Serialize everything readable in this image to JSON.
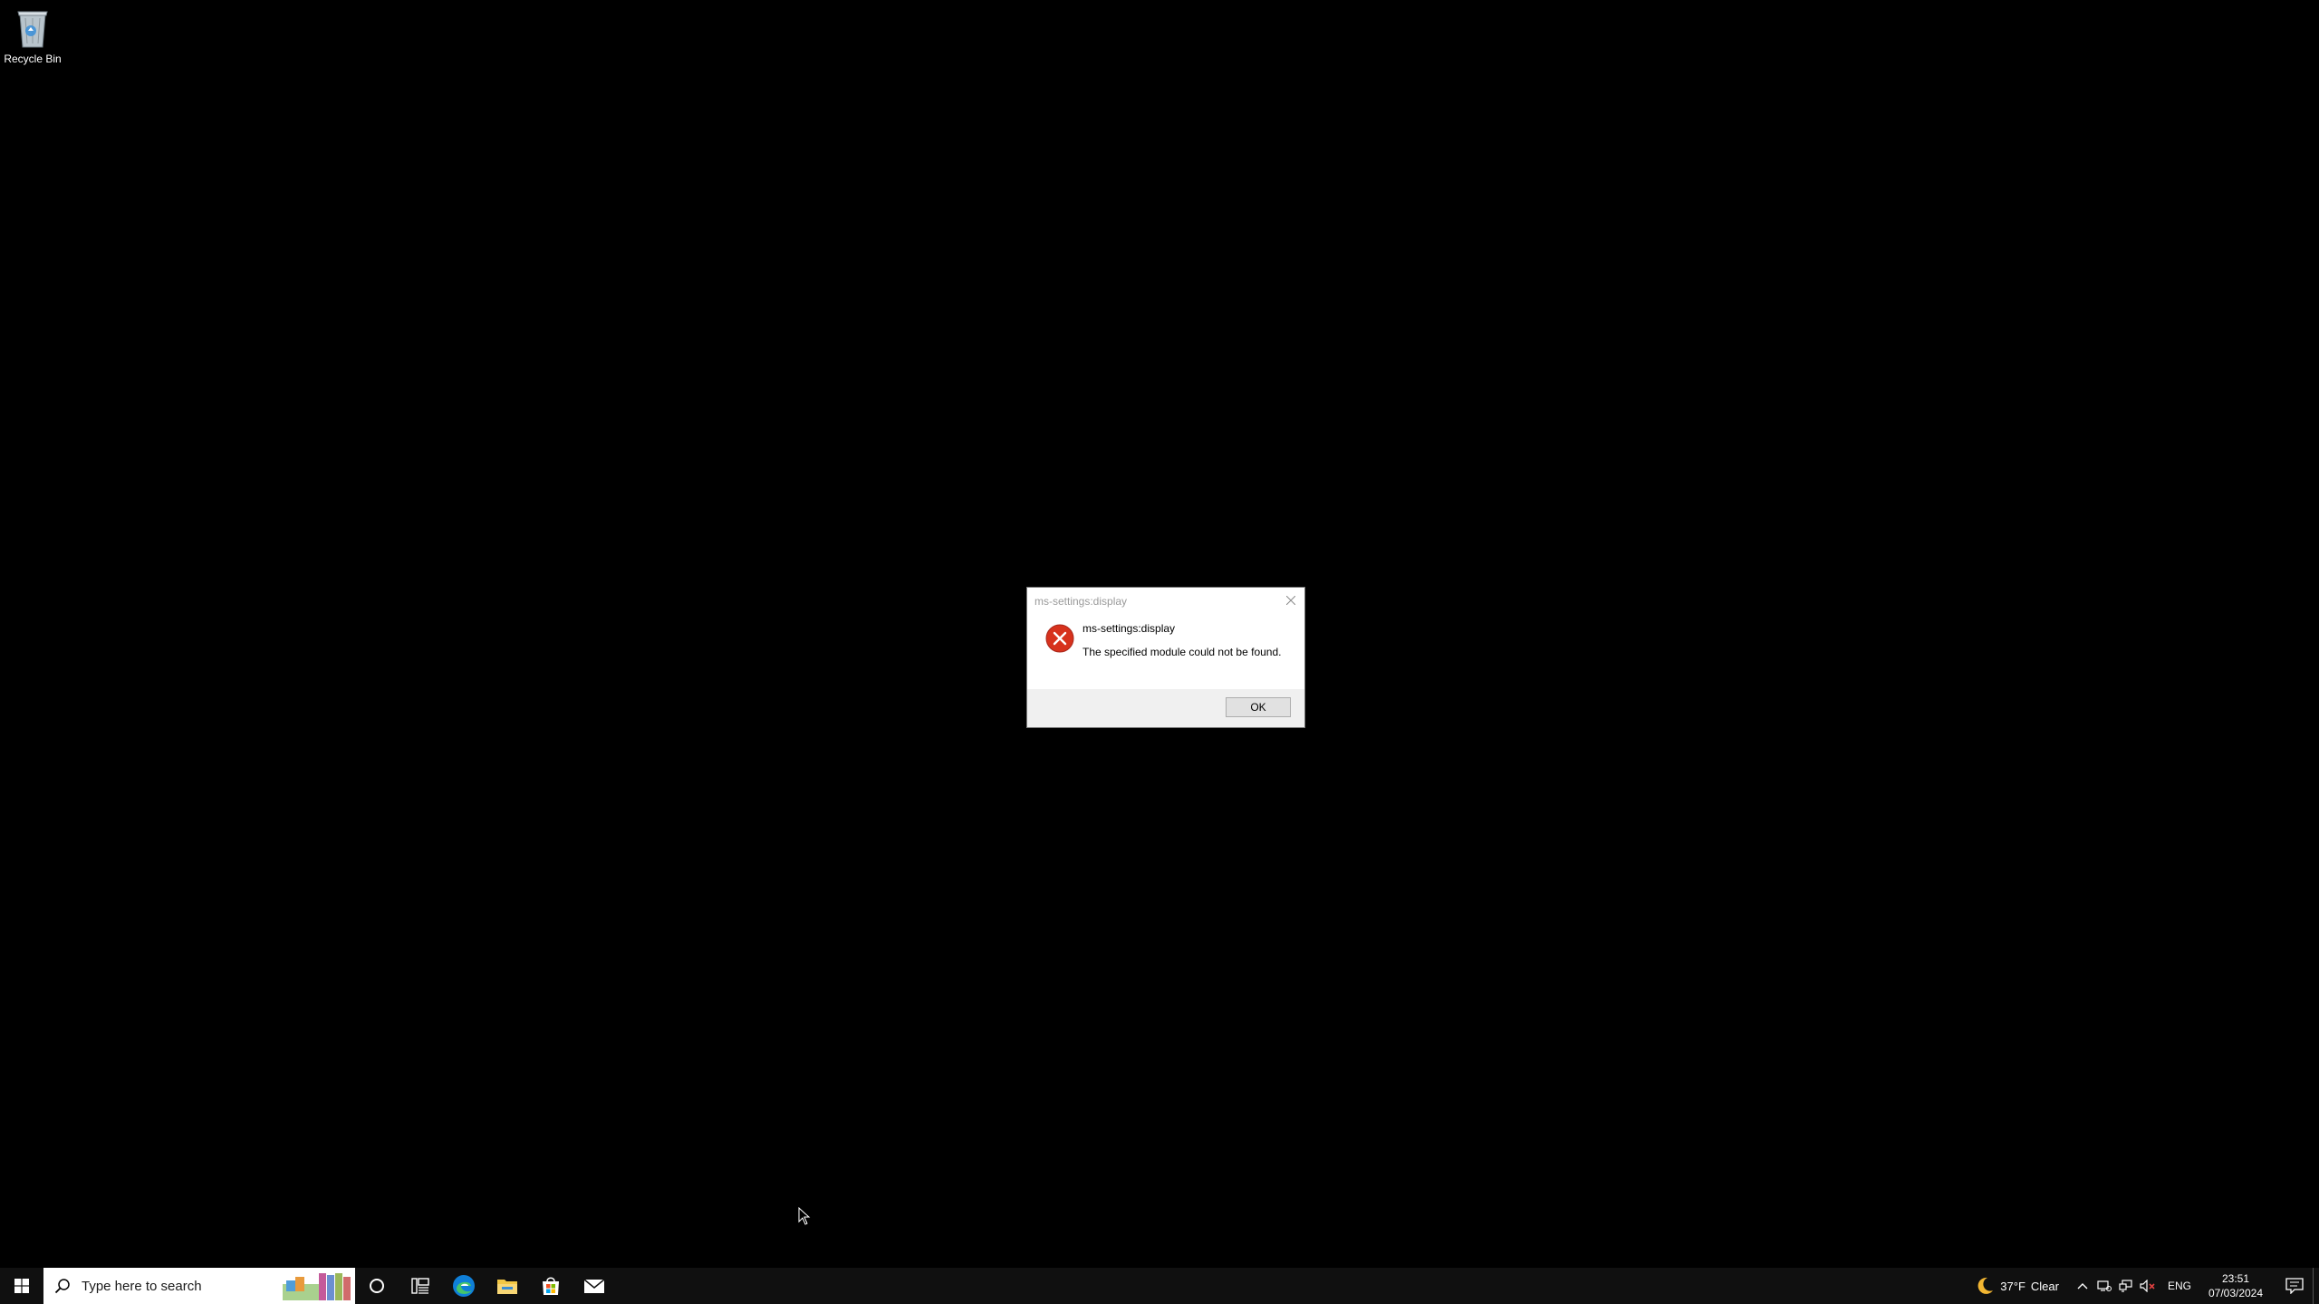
{
  "desktop": {
    "icons": [
      {
        "label": "Recycle Bin",
        "icon": "recycle-bin-icon"
      }
    ]
  },
  "dialog": {
    "title": "ms-settings:display",
    "heading": "ms-settings:display",
    "message": "The specified module could not be found.",
    "ok_label": "OK",
    "icon": "error-icon"
  },
  "taskbar": {
    "search_placeholder": "Type here to search",
    "pinned": [
      "cortana-icon",
      "task-view-icon",
      "edge-icon",
      "file-explorer-icon",
      "store-icon",
      "mail-icon"
    ],
    "weather": {
      "temp": "37°F",
      "condition": "Clear",
      "icon": "moon-icon"
    },
    "language": "ENG",
    "time": "23:51",
    "date": "07/03/2024"
  },
  "colors": {
    "desktop_bg": "#000000",
    "taskbar_bg": "#101010",
    "error_red": "#d7321d"
  }
}
